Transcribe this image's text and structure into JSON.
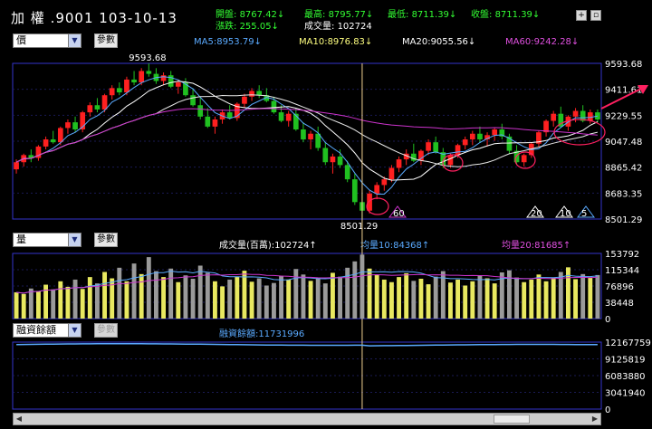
{
  "header": {
    "name": "加  權",
    "code": ".9001",
    "date": "103-10-13",
    "open_label": "開盤",
    "open_value": "8767.42↓",
    "high_label": "最高",
    "high_value": "8795.77↓",
    "low_label": "最低",
    "low_value": "8711.39↓",
    "close_label": "收盤",
    "close_value": "8711.39↓",
    "change_label": "漲跌",
    "change_value": "255.05↓",
    "volume_label": "成交量",
    "volume_value": "102724",
    "btn_add": "+",
    "btn_win": "▫"
  },
  "price_toolbar": {
    "select_value": "價",
    "param_button": "參數",
    "ma5": "MA5:8953.79↓",
    "ma10": "MA10:8976.83↓",
    "ma20": "MA20:9055.56↓",
    "ma60": "MA60:9242.28↓"
  },
  "volume_toolbar": {
    "select_value": "量",
    "param_button": "參數",
    "vol_label": "成交量(百萬):102724↑",
    "avg10": "均量10:84368↑",
    "avg20": "均量20:81685↑"
  },
  "margin_toolbar": {
    "select_value": "融資餘額",
    "param_button": "參數",
    "value_label": "融資餘額:11731996"
  },
  "price_panel": {
    "y_ticks": [
      "9593.68",
      "9411.61",
      "9229.55",
      "9047.48",
      "8865.42",
      "8683.35",
      "8501.29"
    ],
    "high_marker": "9593.68",
    "low_marker": "8501.29",
    "tags": [
      "60",
      "20",
      "10",
      "5"
    ]
  },
  "volume_panel": {
    "y_ticks": [
      "153792",
      "115344",
      "76896",
      "38448",
      "0"
    ]
  },
  "margin_panel": {
    "y_ticks": [
      "12167759",
      "9125819",
      "6083880",
      "3041940",
      "0"
    ]
  },
  "colors": {
    "up": "#ff2020",
    "down": "#20c020",
    "ma5": "#5aaaff",
    "ma10": "#ffffff",
    "ma20": "#e8e8e8",
    "ma60": "#cc33cc",
    "vol_bar": "#e8e860",
    "vol_bar_alt": "#9a9a9a",
    "frame": "#3333cc",
    "cursor": "#f0d090",
    "annotation": "#ff2060"
  },
  "chart_data": [
    {
      "type": "line",
      "ylim": [
        8501.29,
        9593.68
      ],
      "ohlc": [
        [
          8850,
          8920,
          8820,
          8900
        ],
        [
          8900,
          8960,
          8870,
          8950
        ],
        [
          8950,
          8990,
          8900,
          8930
        ],
        [
          8930,
          9020,
          8910,
          9010
        ],
        [
          9010,
          9080,
          8990,
          9060
        ],
        [
          9060,
          9120,
          9030,
          9040
        ],
        [
          9040,
          9150,
          9020,
          9140
        ],
        [
          9140,
          9200,
          9100,
          9180
        ],
        [
          9180,
          9220,
          9110,
          9130
        ],
        [
          9130,
          9260,
          9110,
          9250
        ],
        [
          9250,
          9320,
          9220,
          9300
        ],
        [
          9300,
          9350,
          9250,
          9270
        ],
        [
          9270,
          9380,
          9250,
          9370
        ],
        [
          9370,
          9440,
          9340,
          9420
        ],
        [
          9420,
          9460,
          9370,
          9390
        ],
        [
          9390,
          9500,
          9370,
          9480
        ],
        [
          9480,
          9540,
          9440,
          9460
        ],
        [
          9460,
          9560,
          9440,
          9540
        ],
        [
          9540,
          9593,
          9500,
          9520
        ],
        [
          9520,
          9560,
          9450,
          9470
        ],
        [
          9470,
          9530,
          9440,
          9510
        ],
        [
          9510,
          9540,
          9420,
          9430
        ],
        [
          9430,
          9480,
          9380,
          9460
        ],
        [
          9460,
          9490,
          9360,
          9370
        ],
        [
          9370,
          9420,
          9290,
          9300
        ],
        [
          9300,
          9360,
          9200,
          9220
        ],
        [
          9220,
          9280,
          9140,
          9150
        ],
        [
          9150,
          9220,
          9100,
          9200
        ],
        [
          9200,
          9270,
          9170,
          9250
        ],
        [
          9250,
          9300,
          9200,
          9210
        ],
        [
          9210,
          9320,
          9190,
          9310
        ],
        [
          9310,
          9380,
          9280,
          9360
        ],
        [
          9360,
          9420,
          9330,
          9400
        ],
        [
          9400,
          9440,
          9350,
          9370
        ],
        [
          9370,
          9420,
          9320,
          9330
        ],
        [
          9330,
          9360,
          9240,
          9250
        ],
        [
          9250,
          9300,
          9180,
          9190
        ],
        [
          9190,
          9260,
          9150,
          9240
        ],
        [
          9240,
          9280,
          9120,
          9130
        ],
        [
          9130,
          9180,
          9040,
          9060
        ],
        [
          9060,
          9120,
          8990,
          9100
        ],
        [
          9100,
          9150,
          8980,
          9000
        ],
        [
          9000,
          9040,
          8880,
          8900
        ],
        [
          8900,
          8960,
          8820,
          8940
        ],
        [
          8940,
          8990,
          8860,
          8880
        ],
        [
          8880,
          8910,
          8760,
          8780
        ],
        [
          8780,
          8820,
          8600,
          8620
        ],
        [
          8620,
          8680,
          8501,
          8560
        ],
        [
          8560,
          8700,
          8540,
          8680
        ],
        [
          8680,
          8760,
          8640,
          8740
        ],
        [
          8740,
          8800,
          8700,
          8780
        ],
        [
          8780,
          8880,
          8760,
          8860
        ],
        [
          8860,
          8940,
          8830,
          8920
        ],
        [
          8920,
          8990,
          8880,
          8960
        ],
        [
          8960,
          9030,
          8900,
          8910
        ],
        [
          8910,
          8990,
          8880,
          8980
        ],
        [
          8980,
          9060,
          8950,
          9040
        ],
        [
          9040,
          9080,
          8960,
          8970
        ],
        [
          8970,
          9000,
          8860,
          8880
        ],
        [
          8880,
          8960,
          8860,
          8950
        ],
        [
          8950,
          9030,
          8930,
          9020
        ],
        [
          9020,
          9080,
          8990,
          9060
        ],
        [
          9060,
          9120,
          9020,
          9100
        ],
        [
          9100,
          9150,
          9040,
          9060
        ],
        [
          9060,
          9110,
          9010,
          9090
        ],
        [
          9090,
          9140,
          9050,
          9130
        ],
        [
          9130,
          9170,
          9060,
          9080
        ],
        [
          9080,
          9100,
          8960,
          8980
        ],
        [
          8980,
          9020,
          8880,
          8900
        ],
        [
          8900,
          8960,
          8870,
          8950
        ],
        [
          8950,
          9040,
          8930,
          9030
        ],
        [
          9030,
          9120,
          9010,
          9110
        ],
        [
          9110,
          9200,
          9080,
          9190
        ],
        [
          9190,
          9260,
          9150,
          9240
        ],
        [
          9240,
          9290,
          9140,
          9150
        ],
        [
          9150,
          9230,
          9120,
          9220
        ],
        [
          9220,
          9280,
          9180,
          9260
        ],
        [
          9260,
          9300,
          9180,
          9190
        ],
        [
          9190,
          9270,
          9170,
          9250
        ],
        [
          9250,
          9270,
          9180,
          9200
        ]
      ],
      "ma5_color": "#5aaaff",
      "ma60_color": "#cc33cc"
    },
    {
      "type": "bar",
      "ylim": [
        0,
        153792
      ],
      "values": [
        62000,
        58000,
        71000,
        65000,
        80000,
        69000,
        88000,
        75000,
        92000,
        70000,
        98000,
        83000,
        110000,
        95000,
        120000,
        88000,
        130000,
        105000,
        145000,
        112000,
        98000,
        118000,
        86000,
        102000,
        94000,
        125000,
        108000,
        88000,
        76000,
        92000,
        99000,
        113000,
        87000,
        95000,
        78000,
        84000,
        101000,
        92000,
        117000,
        104000,
        89000,
        96000,
        83000,
        108000,
        99000,
        120000,
        135000,
        151000,
        118000,
        103000,
        92000,
        86000,
        98000,
        107000,
        89000,
        94000,
        81000,
        99000,
        112000,
        85000,
        92000,
        78000,
        88000,
        101000,
        95000,
        83000,
        109000,
        114000,
        97000,
        86000,
        92000,
        104000,
        88000,
        97000,
        110000,
        121000,
        93000,
        105000,
        96000,
        102724
      ]
    },
    {
      "type": "line",
      "ylim": [
        0,
        12167759
      ],
      "last": 11731996
    }
  ]
}
